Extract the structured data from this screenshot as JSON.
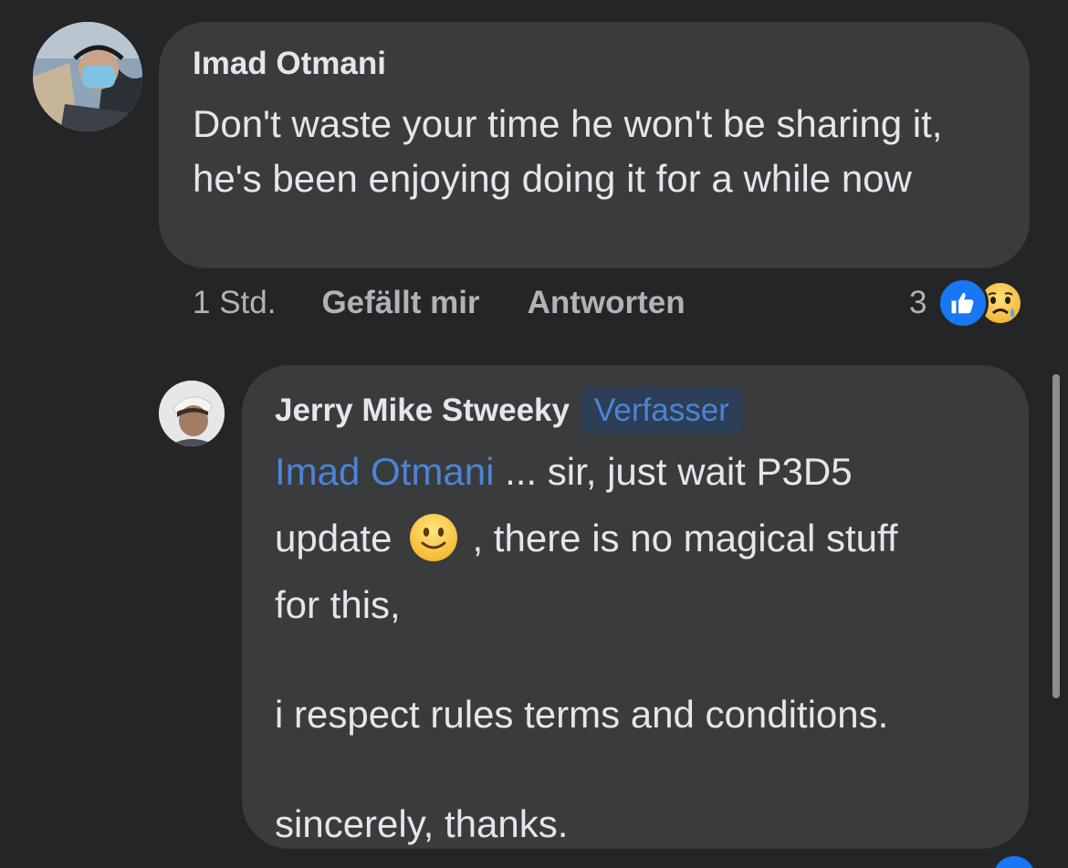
{
  "comments": [
    {
      "author": "Imad Otmani",
      "text": "Don't waste your time he won't be sharing it, he's been enjoying doing it for a while now",
      "time": "1 Std.",
      "like_label": "Gefällt mir",
      "reply_label": "Antworten",
      "reaction_count": "3",
      "reactions": [
        "like-icon",
        "sad-icon"
      ]
    },
    {
      "author": "Jerry Mike Stweeky",
      "badge": "Verfasser",
      "mention": "Imad Otmani",
      "text_line1": " ... sir, just wait P3D5",
      "text_line2a": "update",
      "text_line2b": ", there is no magical stuff",
      "text_line3": "for this,",
      "text_para2": "i respect rules terms and conditions.",
      "text_para3": "sincerely, thanks."
    }
  ],
  "colors": {
    "background": "#242526",
    "bubble": "#3a3b3c",
    "accent": "#4b84d6",
    "like_blue": "#1877f2"
  }
}
